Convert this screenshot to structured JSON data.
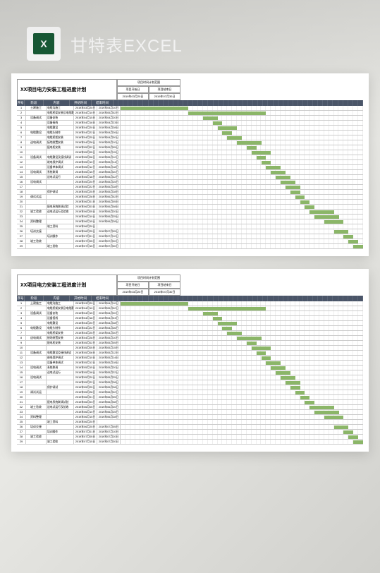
{
  "header": {
    "icon_label": "X",
    "title": "甘特表EXCEL"
  },
  "sheet": {
    "title": "XX项目电力安装工程进度计划",
    "meta_top": "项目时间计划范围",
    "meta_left_label": "项目开始日",
    "meta_left_value": "2019年03月20日",
    "meta_right_label": "项目结束日",
    "meta_right_value": "2019年07月30日",
    "columns": {
      "idx": "序号",
      "stage": "阶段",
      "content": "内容",
      "start": "开始时间",
      "end": "结束时间"
    },
    "gantt_columns": 50,
    "rows": [
      {
        "idx": "1",
        "stage": "土建施工",
        "content": "电缆沟施工",
        "start": "2019年03月20日",
        "end": "2019年04月10日",
        "bar": [
          0,
          14
        ]
      },
      {
        "idx": "2",
        "stage": "",
        "content": "电缆桥架安装及电缆敷设",
        "start": "2019年04月10日",
        "end": "2019年05月02日",
        "bar": [
          14,
          30
        ]
      },
      {
        "idx": "3",
        "stage": "设备调试",
        "content": "设备安装",
        "start": "2019年04月15日",
        "end": "2019年04月20日",
        "bar": [
          17,
          20
        ]
      },
      {
        "idx": "4",
        "stage": "",
        "content": "设备接线",
        "start": "2019年04月18日",
        "end": "2019年04月23日",
        "bar": [
          19,
          21
        ]
      },
      {
        "idx": "5",
        "stage": "",
        "content": "电缆敷设",
        "start": "2019年04月20日",
        "end": "2019年04月28日",
        "bar": [
          20,
          24
        ]
      },
      {
        "idx": "6",
        "stage": "电缆敷设",
        "content": "电缆头制作",
        "start": "2019年04月22日",
        "end": "2019年04月26日",
        "bar": [
          21,
          23
        ]
      },
      {
        "idx": "7",
        "stage": "",
        "content": "电缆桥架安装",
        "start": "2019年04月25日",
        "end": "2019年04月30日",
        "bar": [
          22,
          25
        ]
      },
      {
        "idx": "8",
        "stage": "送电调试",
        "content": "接地装置安装",
        "start": "2019年04月28日",
        "end": "2019年05月10日",
        "bar": [
          24,
          29
        ]
      },
      {
        "idx": "9",
        "stage": "",
        "content": "配电柜安装",
        "start": "2019年05月02日",
        "end": "2019年05月05日",
        "bar": [
          26,
          28
        ]
      },
      {
        "idx": "10",
        "stage": "",
        "content": "",
        "start": "2019年05月05日",
        "end": "2019年05月15日",
        "bar": [
          27,
          31
        ]
      },
      {
        "idx": "11",
        "stage": "设备调试",
        "content": "电缆敷设及接线调试",
        "start": "2019年05月08日",
        "end": "2019年05月12日",
        "bar": [
          28,
          30
        ]
      },
      {
        "idx": "12",
        "stage": "",
        "content": "继电保护调试",
        "start": "2019年05月10日",
        "end": "2019年05月14日",
        "bar": [
          29,
          31
        ]
      },
      {
        "idx": "13",
        "stage": "",
        "content": "设备单体调试",
        "start": "2019年05月12日",
        "end": "2019年05月18日",
        "bar": [
          30,
          33
        ]
      },
      {
        "idx": "14",
        "stage": "设电调试",
        "content": "系统联调",
        "start": "2019年05月15日",
        "end": "2019年05月20日",
        "bar": [
          31,
          34
        ]
      },
      {
        "idx": "15",
        "stage": "",
        "content": "送电试运行",
        "start": "2019年05月18日",
        "end": "2019年05月22日",
        "bar": [
          32,
          35
        ]
      },
      {
        "idx": "16",
        "stage": "设电调试",
        "content": "",
        "start": "2019年05月20日",
        "end": "2019年05月25日",
        "bar": [
          33,
          36
        ]
      },
      {
        "idx": "17",
        "stage": "",
        "content": "",
        "start": "2019年05月22日",
        "end": "2019年05月28日",
        "bar": [
          34,
          37
        ]
      },
      {
        "idx": "18",
        "stage": "",
        "content": "保护调试",
        "start": "2019年05月25日",
        "end": "2019年05月28日",
        "bar": [
          35,
          37
        ]
      },
      {
        "idx": "19",
        "stage": "调试试运",
        "content": "",
        "start": "2019年05月28日",
        "end": "2019年06月02日",
        "bar": [
          36,
          38
        ]
      },
      {
        "idx": "20",
        "stage": "",
        "content": "",
        "start": "2019年06月01日",
        "end": "2019年06月05日",
        "bar": [
          37,
          39
        ]
      },
      {
        "idx": "21",
        "stage": "",
        "content": "配电系统联调试验",
        "start": "2019年06月03日",
        "end": "2019年06月08日",
        "bar": [
          38,
          40
        ]
      },
      {
        "idx": "22",
        "stage": "竣工验收",
        "content": "送电试运行及验收",
        "start": "2019年06月05日",
        "end": "2019年06月20日",
        "bar": [
          39,
          44
        ]
      },
      {
        "idx": "23",
        "stage": "",
        "content": "",
        "start": "2019年06月10日",
        "end": "2019年06月25日",
        "bar": [
          40,
          45
        ]
      },
      {
        "idx": "24",
        "stage": "资料整理",
        "content": "",
        "start": "2019年06月15日",
        "end": "2019年06月28日",
        "bar": [
          42,
          46
        ]
      },
      {
        "idx": "25",
        "stage": "",
        "content": "竣工资料",
        "start": "2019年06月20日",
        "end": "",
        "bar": null
      },
      {
        "idx": "26",
        "stage": "培训交接",
        "content": "",
        "start": "2019年06月25日",
        "end": "2019年07月05日",
        "bar": [
          44,
          47
        ]
      },
      {
        "idx": "27",
        "stage": "",
        "content": "培训操作",
        "start": "2019年07月01日",
        "end": "2019年07月10日",
        "bar": [
          46,
          48
        ]
      },
      {
        "idx": "28",
        "stage": "竣工验收",
        "content": "",
        "start": "2019年07月05日",
        "end": "2019年07月20日",
        "bar": [
          47,
          49
        ]
      },
      {
        "idx": "29",
        "stage": "",
        "content": "竣工验收",
        "start": "2019年07月15日",
        "end": "2019年07月30日",
        "bar": [
          48,
          50
        ]
      }
    ]
  }
}
